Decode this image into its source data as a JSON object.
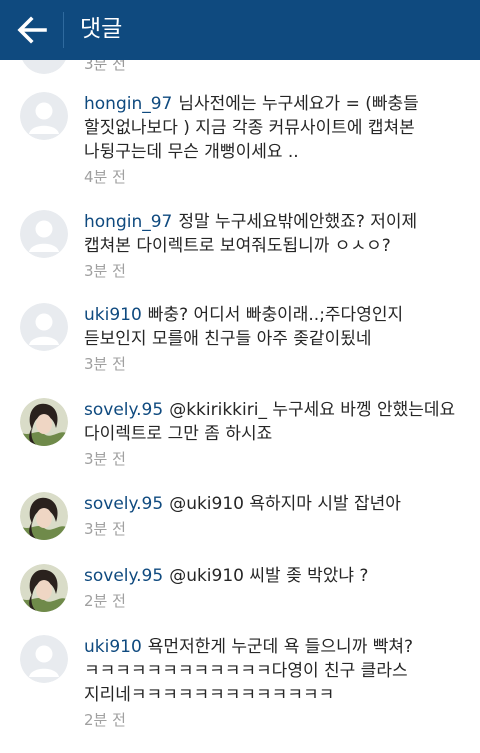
{
  "header": {
    "title": "댓글",
    "bg": "#0f4a7f",
    "back_icon": "arrow-left-icon"
  },
  "partial": {
    "time": "3분 전"
  },
  "comments": [
    {
      "user": "hongin_97",
      "avatar": "default",
      "text": "님사전에는 누구세요가 = (빠충들 할짓없나보다 )  지금 각종 커뮤사이트에 캡쳐본 나뒹구는데 무슨 개뻥이세요 ..",
      "time": "4분 전"
    },
    {
      "user": "hongin_97",
      "avatar": "default",
      "text": "정말 누구세요밖에안했죠? 저이제 캡쳐본 다이렉트로 보여줘도됩니까 ㅇㅅㅇ?",
      "time": "3분 전"
    },
    {
      "user": "uki910",
      "avatar": "default",
      "text": "빠충? 어디서 빠충이래..;주다영인지 듣보인지 모를애 친구들 아주 좆같이됬네",
      "time": "3분 전"
    },
    {
      "user": "sovely.95",
      "avatar": "photo",
      "text": "@kkirikkiri_ 누구세요 바껭 안했는데요 다이렉트로 그만 좀 하시죠",
      "time": "3분 전"
    },
    {
      "user": "sovely.95",
      "avatar": "photo",
      "text": "@uki910 욕하지마 시발 잡년아",
      "time": "3분 전"
    },
    {
      "user": "sovely.95",
      "avatar": "photo",
      "text": "@uki910 씨발 좆 박았냐 ?",
      "time": "2분 전"
    },
    {
      "user": "uki910",
      "avatar": "default",
      "text": "욕먼저한게 누군데 욕 들으니까 빡쳐?ㅋㅋㅋㅋㅋㅋㅋㅋㅋㅋㅋㅋ다영이 친구 클라스 지리네ㅋㅋㅋㅋㅋㅋㅋㅋㅋㅋㅋㅋㅋ",
      "time": "2분 전"
    }
  ]
}
